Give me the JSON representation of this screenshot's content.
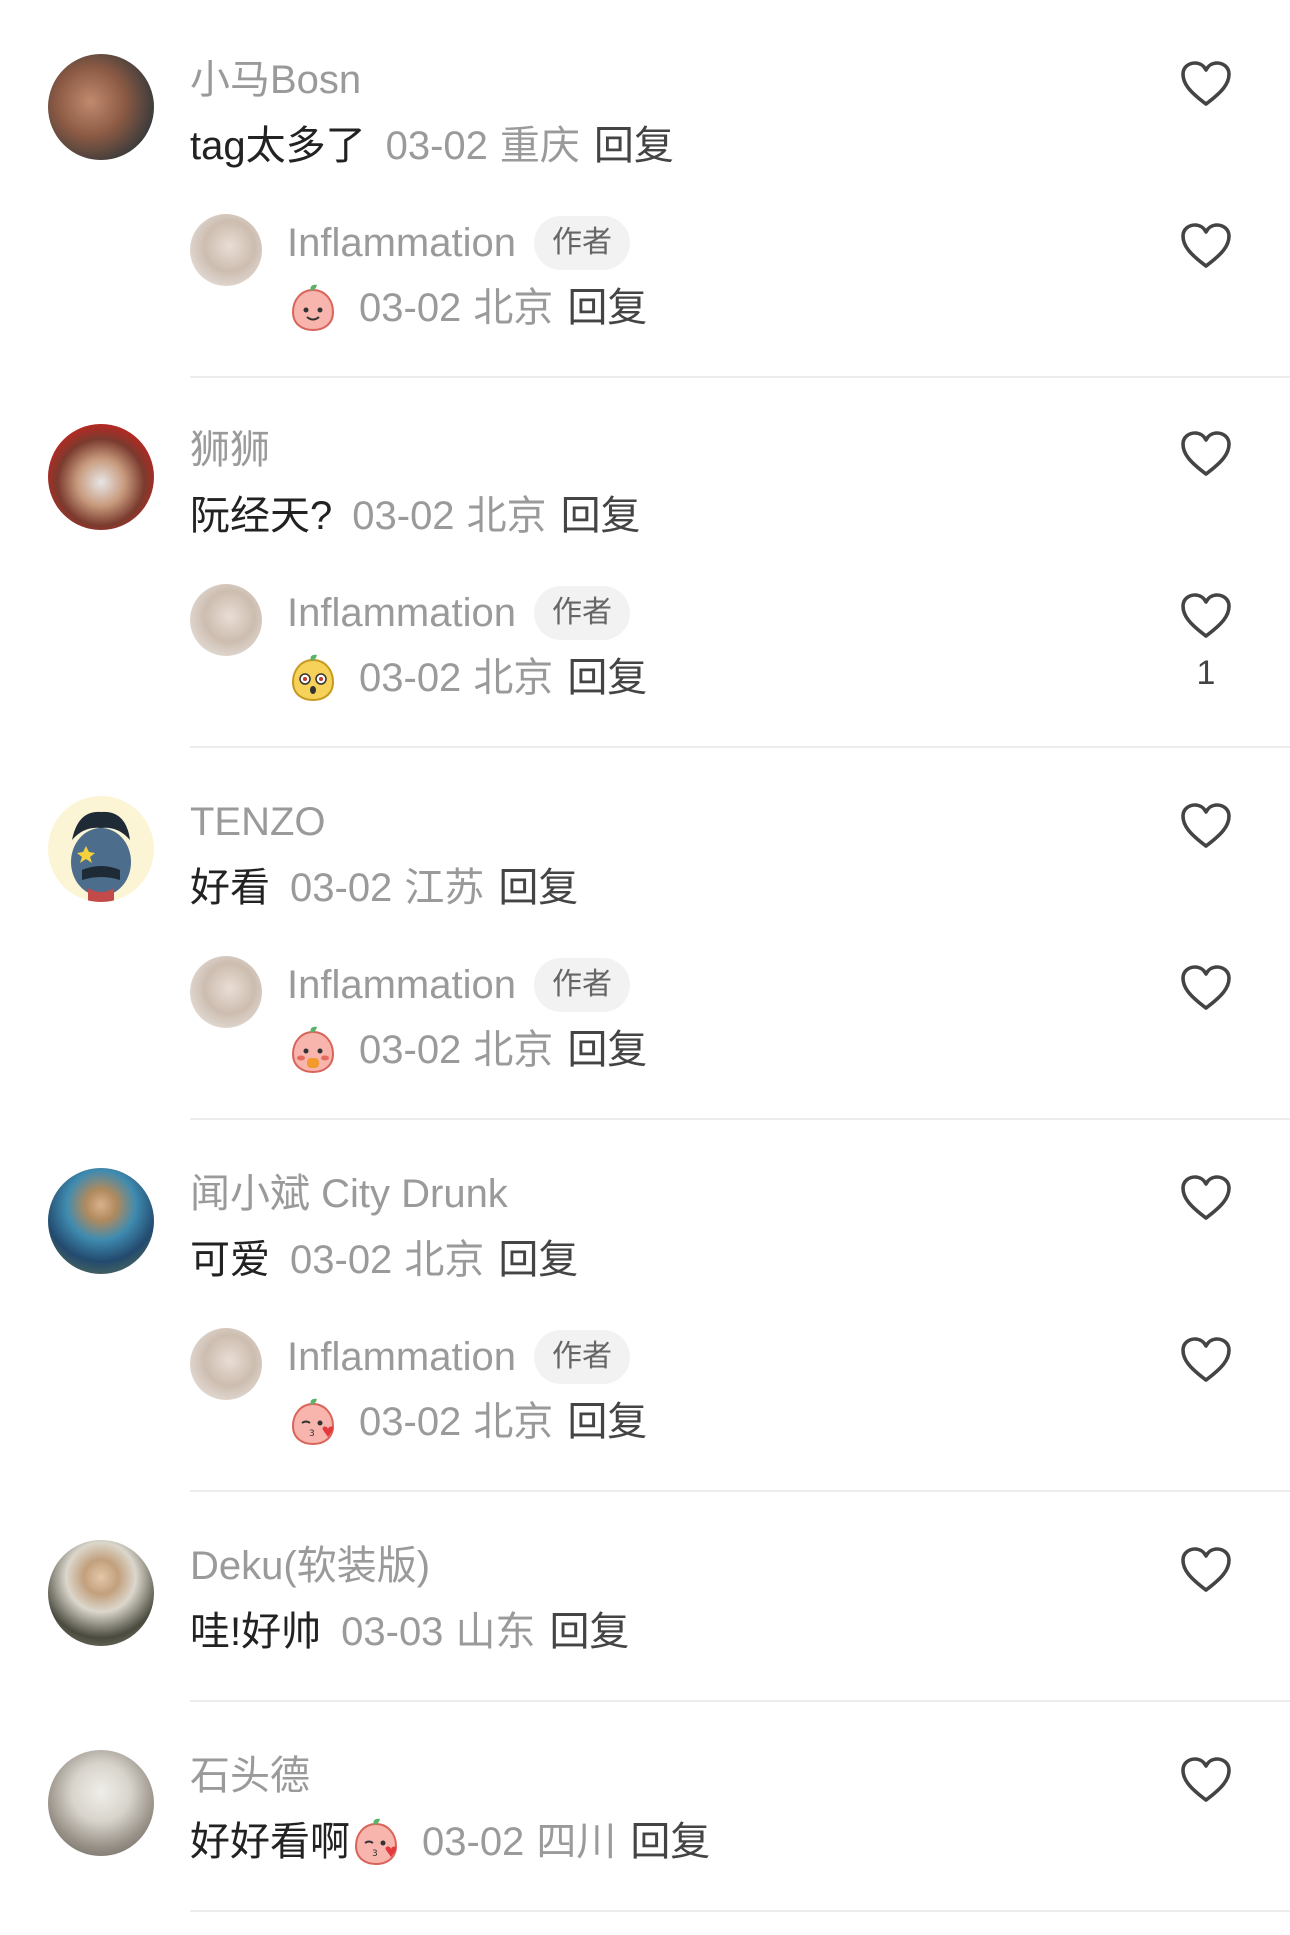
{
  "comments": [
    {
      "user": "小马Bosn",
      "text": "tag太多了",
      "date": "03-02",
      "location": "重庆",
      "reply_label": "回复",
      "reply": {
        "user": "Inflammation",
        "badge": "作者",
        "date": "03-02",
        "location": "北京",
        "reply_label": "回复",
        "emoji": "smile-emoji"
      }
    },
    {
      "user": "狮狮",
      "text": "阮经天?",
      "date": "03-02",
      "location": "北京",
      "reply_label": "回复",
      "reply": {
        "user": "Inflammation",
        "badge": "作者",
        "date": "03-02",
        "location": "北京",
        "reply_label": "回复",
        "emoji": "shocked-emoji",
        "likes": "1"
      }
    },
    {
      "user": "TENZO",
      "text": "好看",
      "date": "03-02",
      "location": "江苏",
      "reply_label": "回复",
      "reply": {
        "user": "Inflammation",
        "badge": "作者",
        "date": "03-02",
        "location": "北京",
        "reply_label": "回复",
        "emoji": "shy-emoji"
      }
    },
    {
      "user": "闻小斌 City Drunk",
      "text": "可爱",
      "date": "03-02",
      "location": "北京",
      "reply_label": "回复",
      "reply": {
        "user": "Inflammation",
        "badge": "作者",
        "date": "03-02",
        "location": "北京",
        "reply_label": "回复",
        "emoji": "kiss-emoji"
      }
    },
    {
      "user": "Deku(软装版)",
      "text": "哇!好帅",
      "date": "03-03",
      "location": "山东",
      "reply_label": "回复"
    },
    {
      "user": "石头德",
      "text": "好好看啊",
      "date": "03-02",
      "location": "四川",
      "reply_label": "回复",
      "emoji": "kiss-emoji"
    }
  ],
  "colors": {
    "name": "#9a9a9a",
    "text": "#222222",
    "divider": "#ededed",
    "heart": "#444444"
  }
}
